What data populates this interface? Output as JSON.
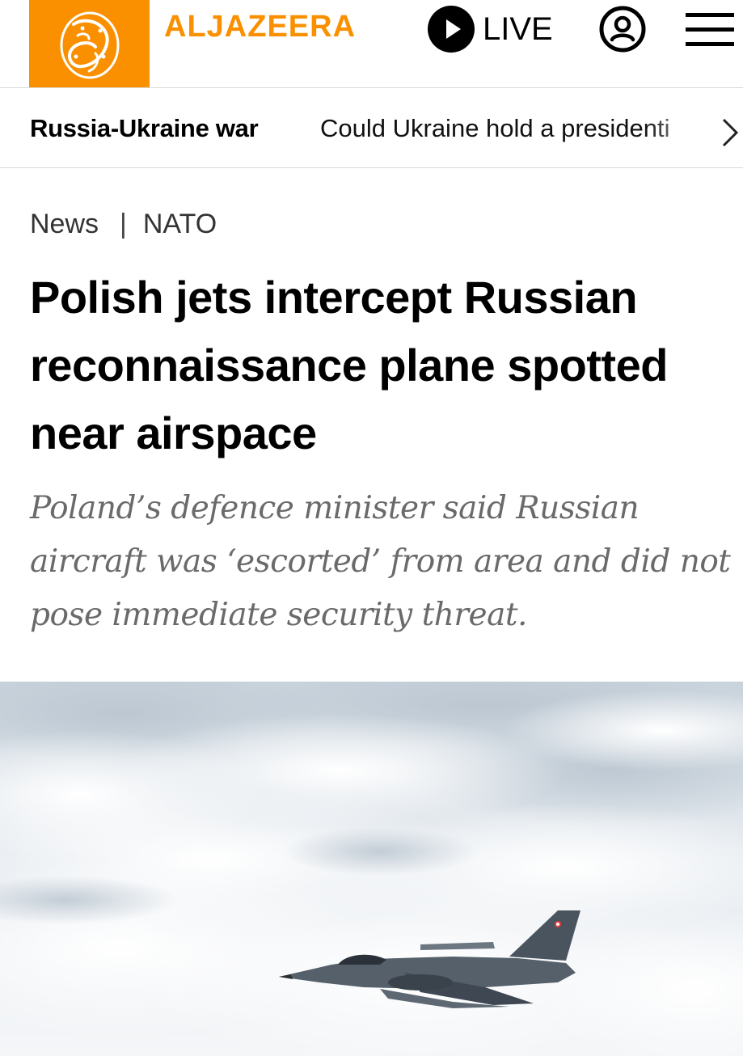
{
  "header": {
    "logo_text": "الجزيرة",
    "brand_name": "ALJAZEERA",
    "live_label": "LIVE",
    "account_icon": "account-icon",
    "menu_icon": "hamburger-menu-icon"
  },
  "topic_bar": {
    "title": "Russia-Ukraine war",
    "link_text": "Could Ukraine hold a presidenti",
    "next_icon": "chevron-right-icon"
  },
  "breadcrumb": {
    "section": "News",
    "separator": "|",
    "topic": "NATO"
  },
  "article": {
    "headline": "Polish jets intercept Russian reconnaissance plane spotted near airspace",
    "standfirst": "Poland’s defence minister said Russian aircraft was ‘escorted’ from area and did not pose immediate security threat."
  },
  "colors": {
    "brand_orange": "#fa9000",
    "text_dark": "#000000",
    "standfirst_gray": "#6a6a6a"
  }
}
